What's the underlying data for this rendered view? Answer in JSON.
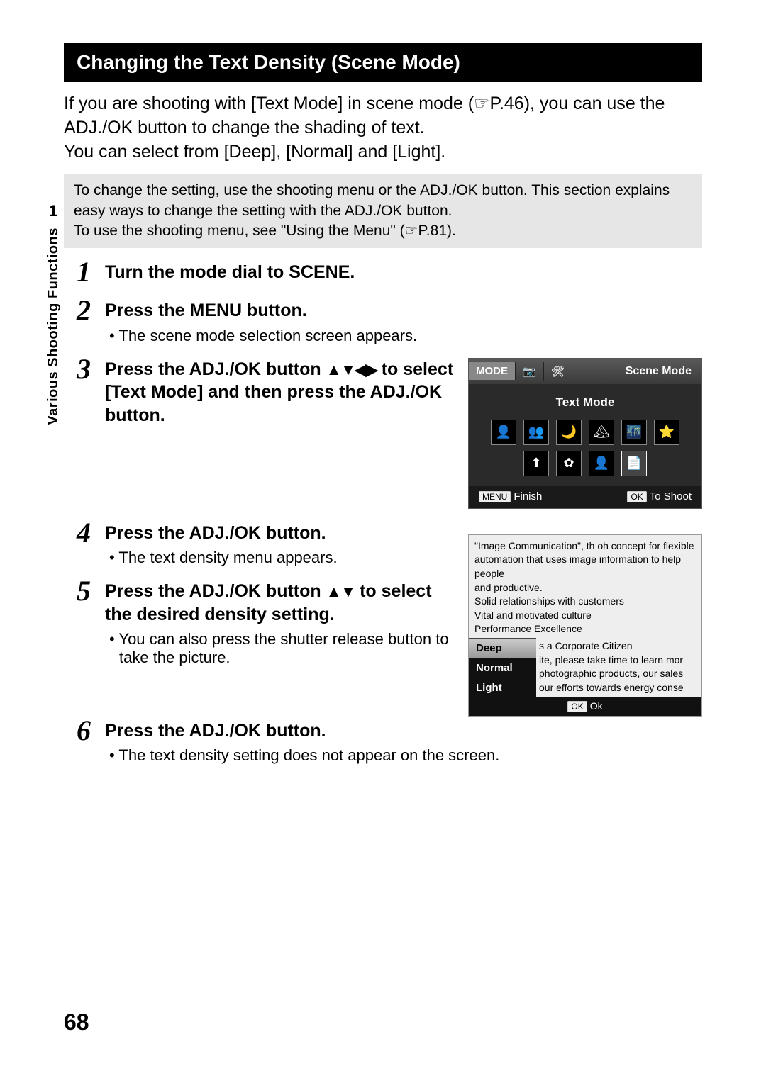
{
  "page_number": "68",
  "sidebar": {
    "chapter": "1",
    "label": "Various Shooting Functions"
  },
  "title": "Changing the Text Density (Scene Mode)",
  "intro_line1": "If you are shooting with [Text Mode] in scene mode (☞P.46), you can use the ADJ./OK button to change the shading of text.",
  "intro_line2": "You can select from [Deep], [Normal] and [Light].",
  "note": {
    "line1": "To change the setting, use the shooting menu or the ADJ./OK button. This section explains easy ways to change the setting with the ADJ./OK button.",
    "line2": "To use the shooting menu, see \"Using the Menu\" (☞P.81)."
  },
  "steps": {
    "s1": {
      "num": "1",
      "title": "Turn the mode dial to SCENE."
    },
    "s2": {
      "num": "2",
      "title": "Press the MENU button.",
      "detail": "The scene mode selection screen appears."
    },
    "s3": {
      "num": "3",
      "title_a": "Press the ADJ./OK button ",
      "title_b": " to select [Text Mode] and then press the ADJ./OK button."
    },
    "s4": {
      "num": "4",
      "title": "Press the ADJ./OK button.",
      "detail": "The text density menu appears."
    },
    "s5": {
      "num": "5",
      "title_a": "Press the ADJ./OK button ",
      "title_b": " to select the desired density setting.",
      "detail": "You can also press the shutter release button to take the picture."
    },
    "s6": {
      "num": "6",
      "title": "Press the ADJ./OK button.",
      "detail": "The text density setting does not appear on the screen."
    }
  },
  "scene_screen": {
    "tab_mode": "MODE",
    "tab_cam": "📷",
    "tab_set": "🛠",
    "title": "Scene Mode",
    "subtitle": "Text Mode",
    "menu_btn": "MENU",
    "finish": "Finish",
    "ok_btn": "OK",
    "to_shoot": "To Shoot"
  },
  "density_screen": {
    "bg_line1": "\"Image Communication\", th     oh concept for flexible",
    "bg_line2": "automation that uses image information to help people",
    "bg_line3": "and productive.",
    "bg_line4": "Solid relationships with customers",
    "bg_line5": "Vital and motivated culture",
    "bg_line6": "Performance Excellence",
    "opt_deep": "Deep",
    "opt_normal": "Normal",
    "opt_light": "Light",
    "rtext1": "s a Corporate Citizen",
    "rtext2": "ite, please take time to learn mor",
    "rtext3": "photographic products, our sales",
    "rtext4": "our efforts towards energy conse",
    "ok_btn": "OK",
    "ok_label": "Ok"
  }
}
